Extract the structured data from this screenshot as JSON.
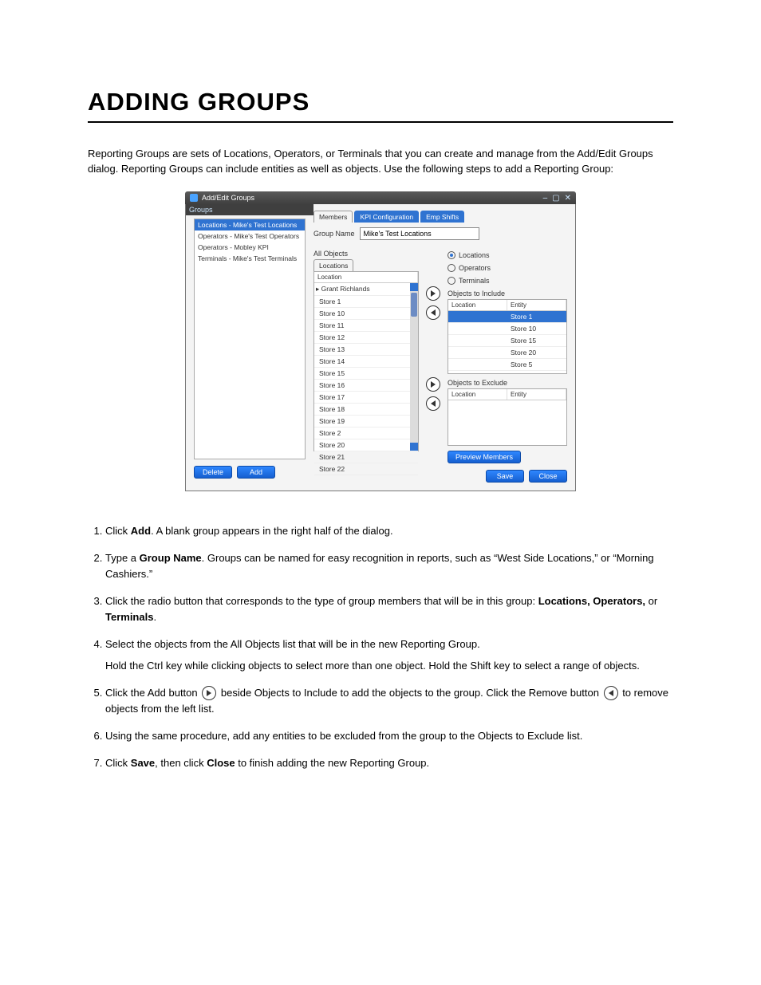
{
  "page": {
    "title": "ADDING GROUPS",
    "intro": "Reporting Groups are sets of Locations, Operators, or Terminals that you can create and manage from the Add/Edit Groups dialog. Reporting Groups can include entities as well as objects. Use the following steps to add a Reporting Group:"
  },
  "dialog": {
    "title": "Add/Edit Groups",
    "groups_label": "Groups",
    "group_items": [
      "Locations - Mike's Test Locations",
      "Operators - Mike's Test Operators",
      "Operators - Mobley KPI",
      "Terminals - Mike's Test Terminals"
    ],
    "delete_btn": "Delete",
    "add_btn": "Add",
    "tabs": {
      "members": "Members",
      "kpi": "KPI Configuration",
      "shifts": "Emp Shifts"
    },
    "group_name_label": "Group Name",
    "group_name_value": "Mike's Test Locations",
    "type_radios": {
      "locations": "Locations",
      "operators": "Operators",
      "terminals": "Terminals"
    },
    "all_objects_label": "All Objects",
    "locations_tab": "Locations",
    "col_location": "Location",
    "col_entity": "Entity",
    "all_rows": [
      "Grant Richlands",
      "Store 1",
      "Store 10",
      "Store 11",
      "Store 12",
      "Store 13",
      "Store 14",
      "Store 15",
      "Store 16",
      "Store 17",
      "Store 18",
      "Store 19",
      "Store 2",
      "Store 20",
      "Store 21",
      "Store 22"
    ],
    "include_label": "Objects to Include",
    "include_rows": [
      {
        "loc": "",
        "ent": "Store 1"
      },
      {
        "loc": "",
        "ent": "Store 10"
      },
      {
        "loc": "",
        "ent": "Store 15"
      },
      {
        "loc": "",
        "ent": "Store 20"
      },
      {
        "loc": "",
        "ent": "Store 5"
      }
    ],
    "exclude_label": "Objects to Exclude",
    "preview_btn": "Preview Members",
    "save_btn": "Save",
    "close_btn": "Close"
  },
  "steps": {
    "s1": {
      "lead": "Click ",
      "b": "Add",
      "tail": ". A blank group appears in the right half of the dialog."
    },
    "s2": {
      "lead": "Type a ",
      "b": "Group Name",
      "tail": ". Groups can be named for easy recognition in reports, such as “West Side Locations,” or “Morning Cashiers.”"
    },
    "s3": {
      "lead": "Click the radio button that corresponds to the type of group members that will be in this group: ",
      "b": "Locations, Operators, ",
      "mid": " or ",
      "b2": "Terminals",
      "tail": "."
    },
    "s4": {
      "lead": "Select the objects from the All Objects list that will be in the new Reporting Group.",
      "sub": "Hold the Ctrl key while clicking objects to select more than one object. Hold the Shift key to select a range of objects."
    },
    "s5": {
      "lead": "Click the Add button ",
      "tail1": " beside Objects to Include to add the objects to the group. Click the Remove button ",
      "tail2": " to remove objects from the left list."
    },
    "s6": {
      "lead": "Using the same procedure, add any entities to be excluded from the group to the Objects to Exclude list."
    },
    "s7": {
      "lead": "Click ",
      "b": "Save",
      "tail": ", then click ",
      "b2": "Close",
      "tail2": " to finish adding the new Reporting Group."
    }
  }
}
